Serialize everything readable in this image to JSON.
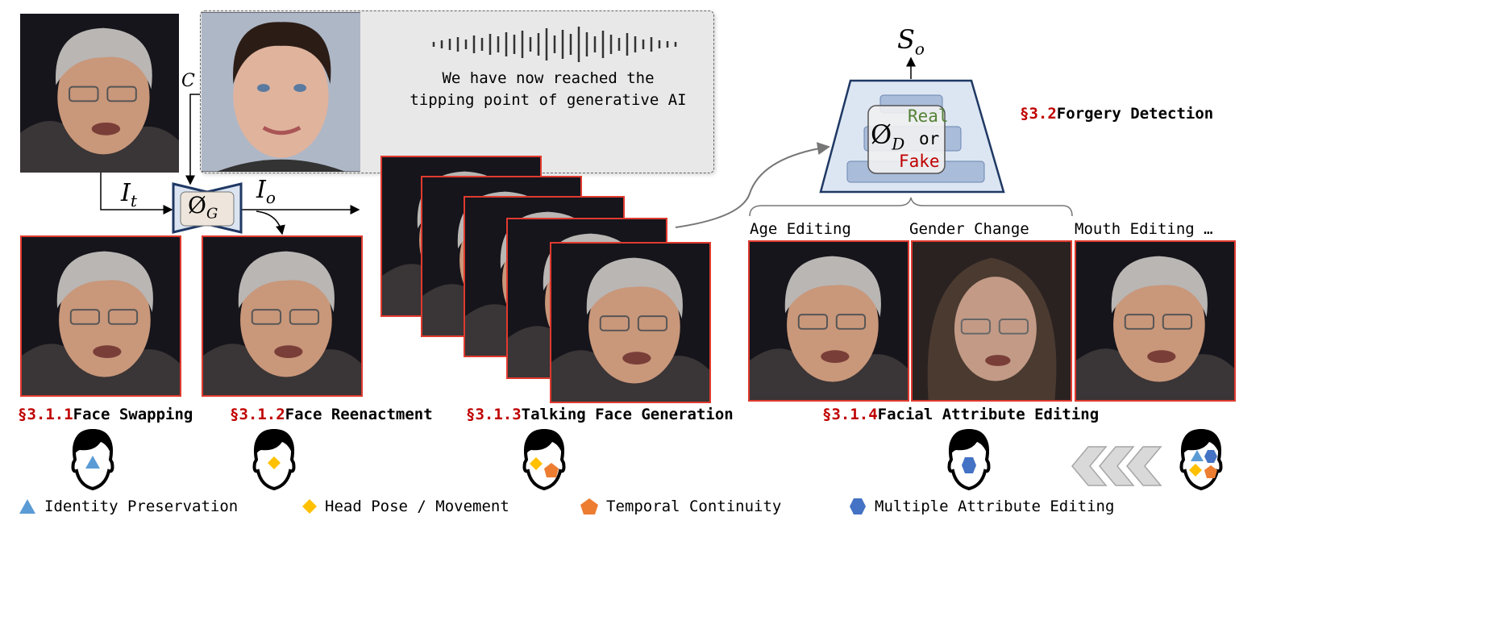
{
  "inputs": {
    "condition_label": "C",
    "target_label": "I",
    "target_sub": "t",
    "output_label": "I",
    "output_sub": "o",
    "generator_label": "Ø",
    "generator_sub": "G",
    "speech_line1": "We have now reached the",
    "speech_line2": "tipping point of generative AI"
  },
  "detector": {
    "score_label": "S",
    "score_sub": "o",
    "symbol": "Ø",
    "symbol_sub": "D",
    "real": "Real",
    "or": "or",
    "fake": "Fake",
    "section_num": "§3.2",
    "section_title": "Forgery Detection"
  },
  "sections": [
    {
      "num": "§3.1.1",
      "title": "Face Swapping"
    },
    {
      "num": "§3.1.2",
      "title": "Face Reenactment"
    },
    {
      "num": "§3.1.3",
      "title": "Talking Face Generation"
    },
    {
      "num": "§3.1.4",
      "title": "Facial Attribute Editing"
    }
  ],
  "attributes": [
    "Age Editing",
    "Gender Change",
    "Mouth Editing …"
  ],
  "legend": [
    {
      "shape": "triangle",
      "color": "#5b9bd5",
      "label": "Identity Preservation"
    },
    {
      "shape": "diamond",
      "color": "#ffc000",
      "label": "Head Pose / Movement"
    },
    {
      "shape": "pentagon",
      "color": "#ed7d31",
      "label": "Temporal Continuity"
    },
    {
      "shape": "hexagon",
      "color": "#4472c4",
      "label": "Multiple Attribute Editing"
    }
  ],
  "colors": {
    "section": "#c00000",
    "real": "#538135",
    "fake": "#c00000",
    "frame": "#e03a2f"
  }
}
